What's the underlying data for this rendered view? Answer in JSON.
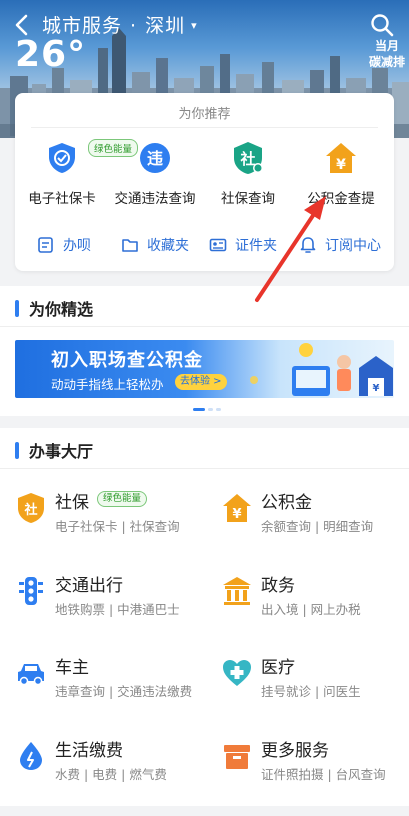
{
  "header": {
    "title": "城市服务",
    "separator": "·",
    "city": "深圳",
    "city_dropdown_glyph": "▾",
    "temperature": "26°",
    "carbon_line1": "当月",
    "carbon_line2": "碳减排"
  },
  "recommend": {
    "title": "为你推荐",
    "green_tag": "绿色能量",
    "items": [
      {
        "label": "电子社保卡",
        "icon": "shebao-card-icon"
      },
      {
        "label": "交通违法查询",
        "icon": "traffic-violation-icon"
      },
      {
        "label": "社保查询",
        "icon": "shebao-shield-icon"
      },
      {
        "label": "公积金查提",
        "icon": "housing-fund-icon"
      }
    ],
    "links": [
      {
        "label": "办呗",
        "icon": "doc-list-icon"
      },
      {
        "label": "收藏夹",
        "icon": "folder-icon"
      },
      {
        "label": "证件夹",
        "icon": "id-card-icon"
      },
      {
        "label": "订阅中心",
        "icon": "bell-icon"
      }
    ]
  },
  "featured": {
    "heading": "为你精选",
    "banner_title": "初入职场查公积金",
    "banner_sub": "动动手指线上轻松办",
    "banner_button": "去体验 >"
  },
  "hall": {
    "heading": "办事大厅",
    "services": [
      {
        "name": "社保",
        "tag": "绿色能量",
        "sub": "电子社保卡 | 社保查询",
        "icon": "shebao-icon",
        "color": "#f2a21b"
      },
      {
        "name": "公积金",
        "tag": "",
        "sub": "余额查询 | 明细查询",
        "icon": "housing-fund-icon",
        "color": "#f2a21b"
      },
      {
        "name": "交通出行",
        "tag": "",
        "sub": "地铁购票 | 中港通巴士",
        "icon": "traffic-light-icon",
        "color": "#2e7ef0"
      },
      {
        "name": "政务",
        "tag": "",
        "sub": "出入境 | 网上办税",
        "icon": "government-building-icon",
        "color": "#f2a21b"
      },
      {
        "name": "车主",
        "tag": "",
        "sub": "违章查询 | 交通违法缴费",
        "icon": "car-icon",
        "color": "#2e7ef0"
      },
      {
        "name": "医疗",
        "tag": "",
        "sub": "挂号就诊 | 问医生",
        "icon": "medical-heart-icon",
        "color": "#36b6c4"
      },
      {
        "name": "生活缴费",
        "tag": "",
        "sub": "水费 | 电费 | 燃气费",
        "icon": "water-drop-icon",
        "color": "#2e7ef0"
      },
      {
        "name": "更多服务",
        "tag": "",
        "sub": "证件照拍摄 | 台风查询",
        "icon": "box-icon",
        "color": "#f07b3a"
      }
    ]
  },
  "colors": {
    "accent_blue": "#2e7ef0",
    "orange": "#f2a21b",
    "green": "#2d9a2a",
    "annotation_red": "#e8352b"
  }
}
